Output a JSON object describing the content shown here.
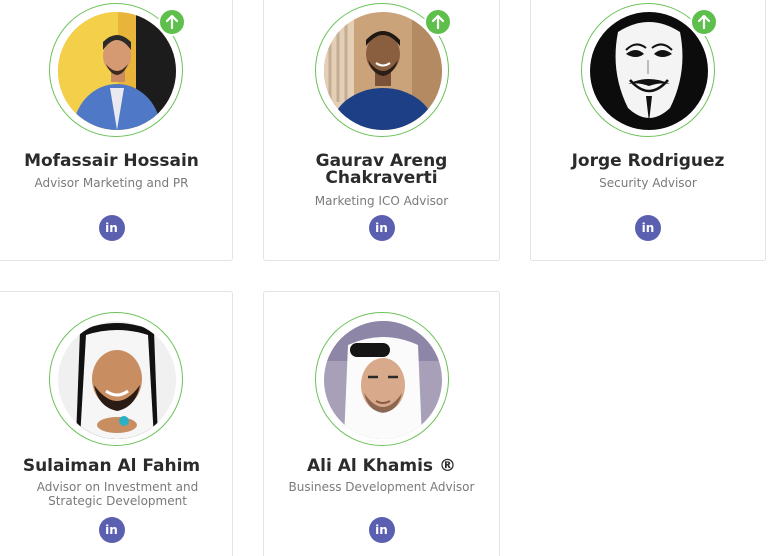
{
  "team": [
    {
      "name": "Mofassair Hossain",
      "role": "Advisor Marketing and PR",
      "social_icon": "linkedin-icon",
      "social_label": "in",
      "has_badge": true,
      "badge_icon": "arrow-up-icon"
    },
    {
      "name": "Gaurav Areng Chakraverti",
      "role": "Marketing ICO Advisor",
      "social_icon": "linkedin-icon",
      "social_label": "in",
      "has_badge": true,
      "badge_icon": "arrow-up-icon"
    },
    {
      "name": "Jorge Rodriguez",
      "role": "Security Advisor",
      "social_icon": "linkedin-icon",
      "social_label": "in",
      "has_badge": true,
      "badge_icon": "arrow-up-icon"
    },
    {
      "name": "Sulaiman Al Fahim",
      "role": "Advisor on Investment and Strategic Development",
      "social_icon": "linkedin-icon",
      "social_label": "in",
      "has_badge": false
    },
    {
      "name": "Ali Al Khamis ®",
      "role": "Business Development Advisor",
      "social_icon": "linkedin-icon",
      "social_label": "in",
      "has_badge": false
    }
  ],
  "colors": {
    "ring": "#6cc25a",
    "badge": "#5fbf4d",
    "linkedin": "#5a5fb0",
    "name_text": "#2b2b2b",
    "role_text": "#7a7a7a",
    "card_border": "#e3e3e3"
  }
}
